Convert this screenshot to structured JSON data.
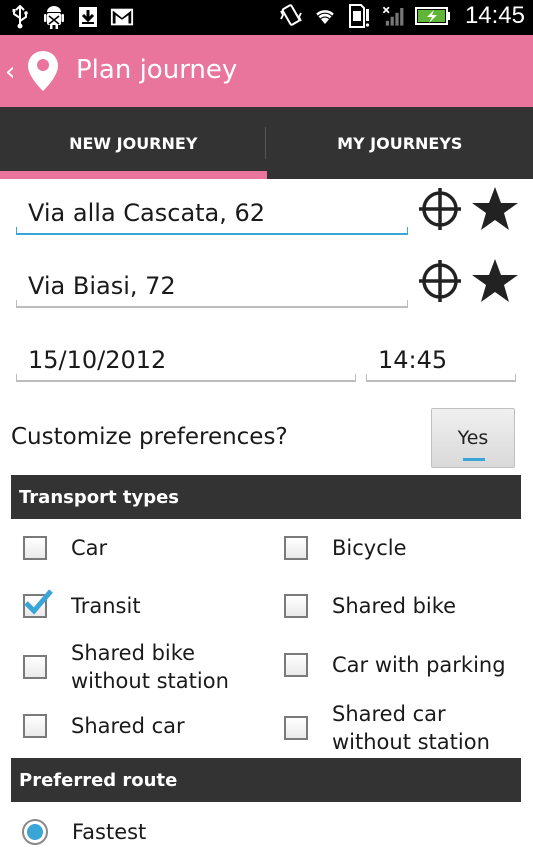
{
  "status_bar": {
    "time": "14:45",
    "left_icons": [
      "usb-icon",
      "android-debug-icon",
      "download-icon",
      "gmail-icon"
    ],
    "right_icons": [
      "vibrate-icon",
      "wifi-icon",
      "sd-card-icon",
      "signal-icon",
      "battery-charging-icon"
    ]
  },
  "action_bar": {
    "title": "Plan journey",
    "back_icon": "chevron-left-icon",
    "app_icon": "location-pin-icon"
  },
  "tabs": [
    {
      "label": "NEW JOURNEY",
      "active": true
    },
    {
      "label": "MY JOURNEYS",
      "active": false
    }
  ],
  "form": {
    "from": "Via alla Cascata, 62",
    "to": "Via Biasi, 72",
    "date": "15/10/2012",
    "time": "14:45"
  },
  "preferences": {
    "label": "Customize preferences?",
    "toggle": "Yes"
  },
  "transport_types": {
    "header": "Transport types",
    "options": [
      {
        "label": "Car",
        "checked": false
      },
      {
        "label": "Bicycle",
        "checked": false
      },
      {
        "label": "Transit",
        "checked": true
      },
      {
        "label": "Shared bike",
        "checked": false
      },
      {
        "label": "Shared bike without station",
        "line1": "Shared bike",
        "line2": "without station",
        "checked": false
      },
      {
        "label": "Car with parking",
        "checked": false
      },
      {
        "label": "Shared car",
        "checked": false
      },
      {
        "label": "Shared car without station",
        "line1": "Shared car",
        "line2": "without station",
        "checked": false
      }
    ]
  },
  "preferred_route": {
    "header": "Preferred route",
    "options": [
      {
        "label": "Fastest",
        "selected": true
      }
    ]
  },
  "colors": {
    "accent_pink": "#e9759c",
    "dark_bar": "#333333",
    "focus_blue": "#3aa6d8"
  }
}
